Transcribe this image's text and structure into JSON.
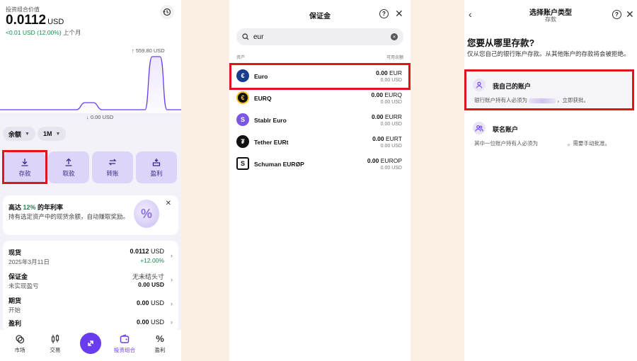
{
  "portfolio": {
    "value_label": "投资组合价值",
    "balance": "0.0112",
    "currency": "USD",
    "change": "<0.01 USD (12.00%)",
    "change_period": "上个月",
    "chart_high_label": "↑ 559.80 USD",
    "chart_low_label": "↓ 0.00 USD",
    "dropdown_balance": "余额",
    "dropdown_range": "1M",
    "actions": [
      "存款",
      "取款",
      "转账",
      "盈利"
    ],
    "promo": {
      "title_prefix": "高达 ",
      "title_highlight": "12%",
      "title_suffix": " 的年利率",
      "description": "持有选定资产中的现货余额，自动赚取奖励。"
    },
    "rows": [
      {
        "name": "现货",
        "sub": "2025年3月11日",
        "value": "0.0112",
        "unit": "USD",
        "value2": "+12.00%"
      },
      {
        "name": "保证金",
        "sub": "未实现盈亏",
        "value": "无未结头寸",
        "unit": "",
        "value2": "0.00 USD"
      },
      {
        "name": "期货",
        "sub": "开始",
        "value": "0.00",
        "unit": "USD",
        "value2": ""
      },
      {
        "name": "盈利",
        "sub": "",
        "value": "0.00",
        "unit": "USD",
        "value2": ""
      }
    ],
    "nav": [
      "市场",
      "交易",
      "",
      "投资组合",
      "盈利"
    ],
    "accent_color": "#6a3cf0",
    "positive_color": "#178a4b"
  },
  "margin": {
    "title": "保证金",
    "search_value": "eur",
    "col_asset": "资产",
    "col_balance": "可用余额",
    "coins": [
      {
        "name": "Euro",
        "amount": "0.00",
        "ticker": "EUR",
        "usd": "0.00 USD",
        "color": "#1a3c8f",
        "glyph": "€"
      },
      {
        "name": "EURQ",
        "amount": "0.00",
        "ticker": "EURQ",
        "usd": "0.00 USD",
        "color": "#111111",
        "glyph": "€"
      },
      {
        "name": "Stablr Euro",
        "amount": "0.00",
        "ticker": "EURR",
        "usd": "0.00 USD",
        "color": "#7a55e8",
        "glyph": "S"
      },
      {
        "name": "Tether EURt",
        "amount": "0.00",
        "ticker": "EURT",
        "usd": "0.00 USD",
        "color": "#111111",
        "glyph": "₮"
      },
      {
        "name": "Schuman EURØP",
        "amount": "0.00",
        "ticker": "EUROP",
        "usd": "0.00 USD",
        "color": "#ffffff",
        "glyph": "S"
      }
    ]
  },
  "account_type": {
    "title": "选择账户类型",
    "subtitle": "存款",
    "question": "您要从哪里存款?",
    "description": "仅从您自己的银行账户存款。从其他账户的存款将会被拒绝。",
    "options": [
      {
        "title": "我自己的账户",
        "desc_before": "银行账户持有人必须为",
        "desc_after": "，立即获批。"
      },
      {
        "title": "联名账户",
        "desc_before": "其中一位账户持有人必须为",
        "desc_after": "。需要手动批准。"
      }
    ]
  }
}
